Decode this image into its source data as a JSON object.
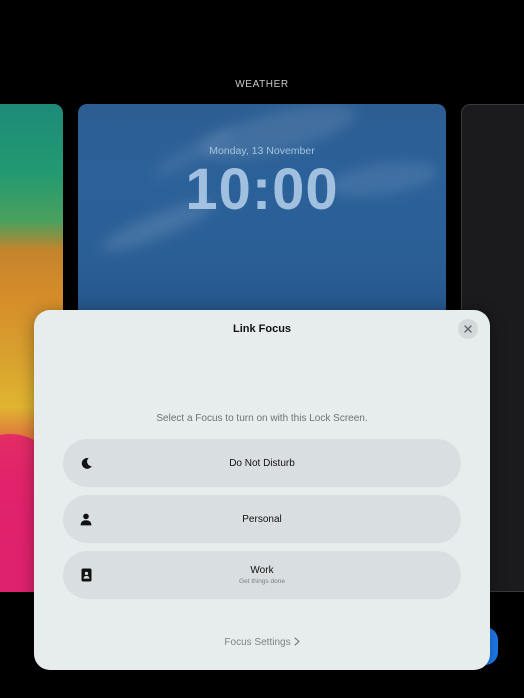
{
  "gallery": {
    "label": "WEATHER"
  },
  "lock_screen": {
    "date": "Monday, 13 November",
    "time": "10:00"
  },
  "sheet": {
    "title": "Link Focus",
    "subtitle": "Select a Focus to turn on with this Lock Screen.",
    "close_icon": "xmark-icon",
    "options": [
      {
        "icon": "moon-icon",
        "label": "Do Not Disturb",
        "sublabel": ""
      },
      {
        "icon": "person-icon",
        "label": "Personal",
        "sublabel": ""
      },
      {
        "icon": "id-badge-icon",
        "label": "Work",
        "sublabel": "Get things done"
      }
    ],
    "settings_link": "Focus Settings"
  },
  "colors": {
    "sheet_background": "#e7eced",
    "option_background": "#d9dfe1",
    "accent": "#1e7cf0"
  }
}
